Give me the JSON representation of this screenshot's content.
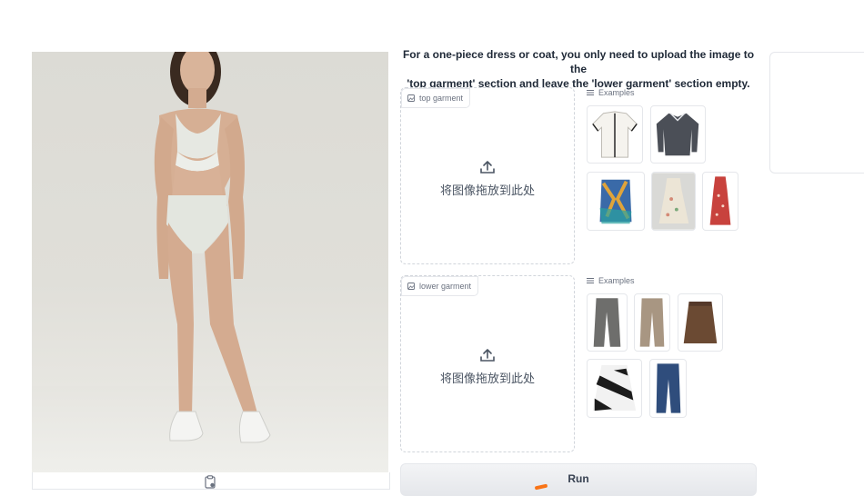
{
  "instruction": {
    "line1": "For a one-piece dress or coat, you only need to upload the image to the",
    "line2": "'top garment' section and leave the 'lower garment' section empty."
  },
  "top_garment": {
    "label": "top garment",
    "drop_text": "将图像拖放到此处",
    "examples_label": "Examples",
    "examples": [
      {
        "name": "white-cardigan",
        "color": "#f5f3ee"
      },
      {
        "name": "grey-knit-polo",
        "color": "#4b4f57"
      },
      {
        "name": "patterned-vest",
        "color": "#3a6aa8"
      },
      {
        "name": "floral-dress",
        "color": "#e9e1d3"
      },
      {
        "name": "red-floral-dress",
        "color": "#c8423d"
      }
    ]
  },
  "lower_garment": {
    "label": "lower garment",
    "drop_text": "将图像拖放到此处",
    "examples_label": "Examples",
    "examples": [
      {
        "name": "grey-trousers",
        "color": "#6e6e6c"
      },
      {
        "name": "beige-trousers",
        "color": "#a89682"
      },
      {
        "name": "leather-skirt",
        "color": "#6b4a33"
      },
      {
        "name": "striped-skirt",
        "color": "#1c1c1c"
      },
      {
        "name": "blue-jeans",
        "color": "#2f4d7c"
      }
    ]
  },
  "run_button": {
    "label": "Run"
  }
}
